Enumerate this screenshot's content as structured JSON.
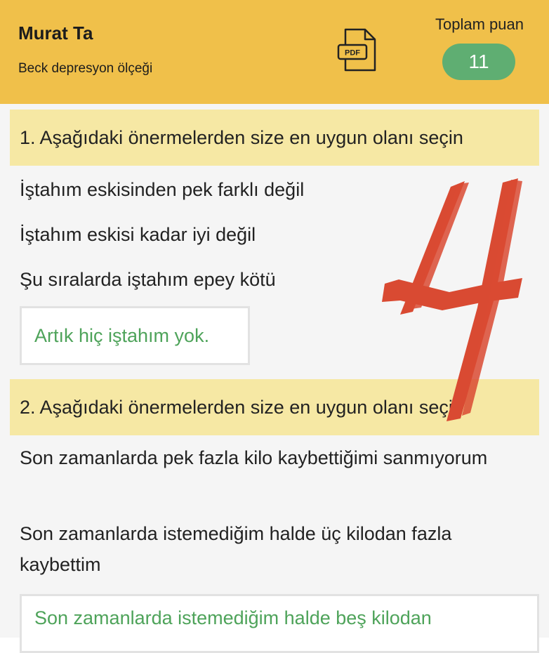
{
  "header": {
    "name": "Murat Ta",
    "subtitle": "Beck depresyon ölçeği",
    "pdf_icon_label": "PDF",
    "total_label": "Toplam puan",
    "total_score": "11",
    "bg_color": "#f0c04a",
    "score_color": "#5fae72"
  },
  "questions": [
    {
      "title": "1. Aşağıdaki önermelerden size en uygun olanı seçin",
      "options": [
        "İştahım eskisinden pek farklı değil",
        "İştahım eskisi kadar iyi değil",
        "Şu sıralarda iştahım epey kötü"
      ],
      "selected": "Artık hiç iştahım yok."
    },
    {
      "title": "2. Aşağıdaki önermelerden size en uygun olanı seçin",
      "options": [
        "Son zamanlarda pek fazla kilo kaybettiğimi sanmıyorum",
        "Son zamanlarda istemediğim halde üç kilodan fazla kaybettim"
      ],
      "selected": "Son zamanlarda istemediğim halde beş kilodan"
    }
  ],
  "overlay": {
    "number": "4",
    "color": "#d94a32"
  },
  "colors": {
    "question_bg": "#f6e8a4",
    "selected_text": "#4ea35a"
  }
}
